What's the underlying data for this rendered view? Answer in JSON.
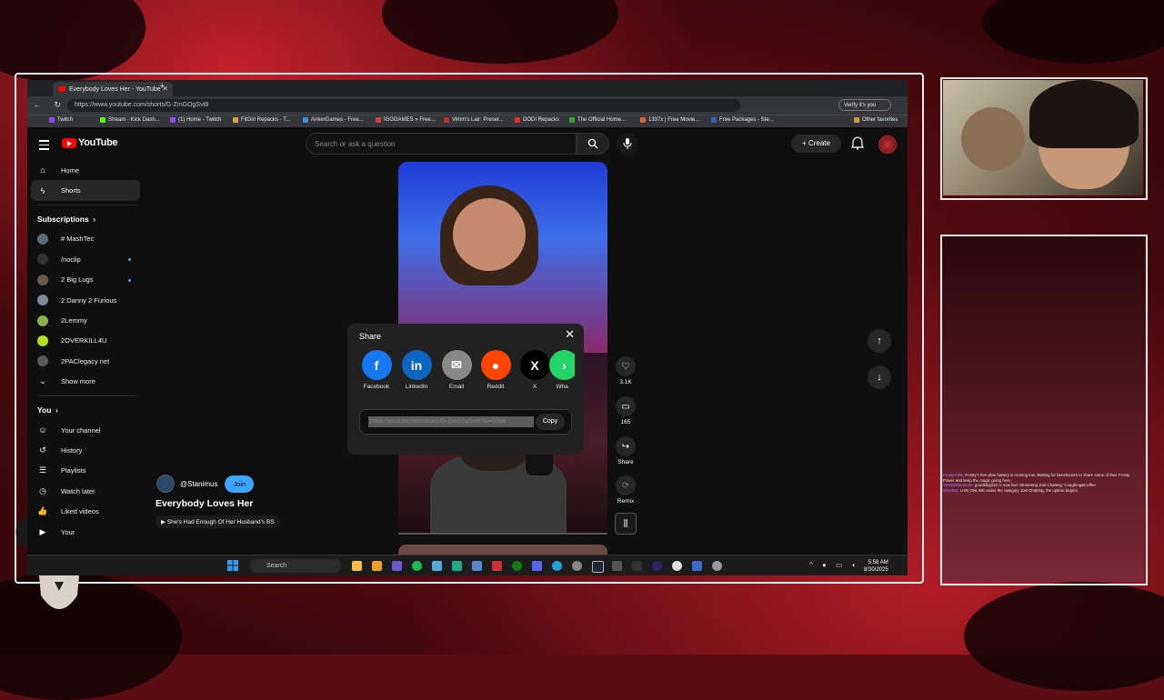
{
  "browser": {
    "tab_title": "Everybody Loves Her - YouTube",
    "url": "https://www.youtube.com/shorts/G-ZmGOgSvt8",
    "verify_label": "Verify it's you",
    "bookmarks": [
      {
        "label": "Twitch",
        "color": "#9146ff"
      },
      {
        "label": "Stream - Kick Dash...",
        "color": "#53fc18"
      },
      {
        "label": "(1) Home - Twitch",
        "color": "#9146ff"
      },
      {
        "label": "FitGirl Repacks - T...",
        "color": "#e0a040"
      },
      {
        "label": "AnkerGames - Free...",
        "color": "#4a8ad4"
      },
      {
        "label": "IGGGAMES » Free...",
        "color": "#d04040"
      },
      {
        "label": "Vimm's Lair: Preser...",
        "color": "#c03030"
      },
      {
        "label": "DODI Repacks",
        "color": "#e03030"
      },
      {
        "label": "The Official Home...",
        "color": "#30a030"
      },
      {
        "label": "1337x | Free Movie...",
        "color": "#e06030"
      },
      {
        "label": "Free Packages - Ste...",
        "color": "#3060c0"
      }
    ],
    "other_favorites": "Other favorites"
  },
  "youtube": {
    "logo_text": "YouTube",
    "search_placeholder": "Search or ask a question",
    "create_label": "Create",
    "sidebar": {
      "home": "Home",
      "shorts": "Shorts",
      "subscriptions_header": "Subscriptions",
      "subscriptions": [
        {
          "label": "# MashTec",
          "color": "#5a6a7a",
          "dot": false
        },
        {
          "label": "/noclip",
          "color": "#333333",
          "dot": true
        },
        {
          "label": "2 Big Lugs",
          "color": "#6a5a4a",
          "dot": true
        },
        {
          "label": "2 Danny 2 Furious",
          "color": "#7a8a9a",
          "dot": false
        },
        {
          "label": "2Lemmy",
          "color": "#8ab04a",
          "dot": false
        },
        {
          "label": "2OVERKILL4U",
          "color": "#b0e020",
          "dot": false
        },
        {
          "label": "2PAClegacy net",
          "color": "#5a5a5a",
          "dot": false
        }
      ],
      "show_more": "Show more",
      "you_header": "You",
      "you_items": [
        "Your channel",
        "History",
        "Playlists",
        "Watch later",
        "Liked videos",
        "Your"
      ]
    },
    "short": {
      "channel": "@Stanimus",
      "join_label": "Join",
      "title": "Everybody Loves Her",
      "sound": "She's Had Enough Of Her Husband's BS",
      "likes": "3.1K",
      "comments": "165",
      "share_label": "Share",
      "remix_label": "Remix"
    },
    "share_dialog": {
      "title": "Share",
      "options": [
        {
          "label": "Facebook",
          "color": "#1877f2",
          "glyph": "f"
        },
        {
          "label": "LinkedIn",
          "color": "#0a66c2",
          "glyph": "in"
        },
        {
          "label": "Email",
          "color": "#888888",
          "glyph": "✉"
        },
        {
          "label": "Reddit",
          "color": "#ff4500",
          "glyph": "●"
        },
        {
          "label": "X",
          "color": "#000000",
          "glyph": "X"
        },
        {
          "label": "Wha",
          "color": "#25d366",
          "glyph": "›"
        }
      ],
      "link": "https://youtube.com/shorts/G-ZmGOgSvt8?si=G5b6",
      "copy_label": "Copy"
    }
  },
  "taskbar": {
    "search_label": "Search",
    "time": "5:58 AM",
    "date": "8/30/2025"
  },
  "chat_lines": [
    {
      "user": "FrostyTollis:",
      "text": "Frosty's free-plan battery is running low. Waiting for benefactors to share some of their Frosty Power and keep the magic going here."
    },
    {
      "user": "StreamElements:",
      "text": "goodking233 is now live! Streaming Just Chatting: Coughing&Coffee"
    },
    {
      "user": "WizeBot:",
      "text": "LIVE ONLINE under the category Just Chatting, the uptime begins."
    }
  ]
}
